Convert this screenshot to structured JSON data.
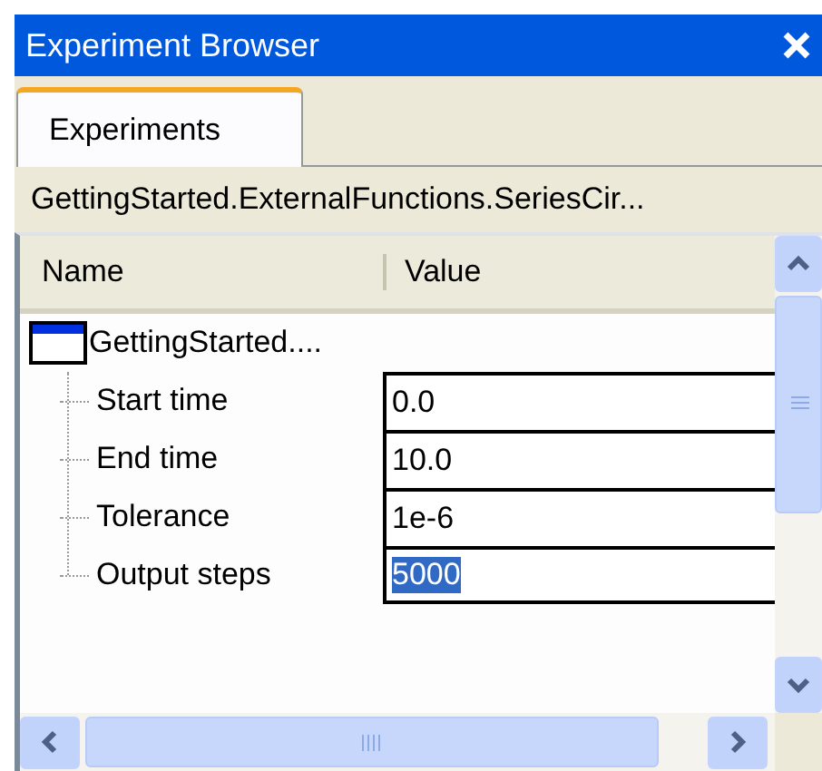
{
  "window": {
    "title": "Experiment Browser"
  },
  "tabs": [
    {
      "label": "Experiments",
      "selected": true
    }
  ],
  "path": "GettingStarted.ExternalFunctions.SeriesCir...",
  "table": {
    "columns": [
      "Name",
      "Value"
    ],
    "root": {
      "label": "GettingStarted....",
      "children": [
        {
          "name": "Start time",
          "value": "0.0",
          "selected": false
        },
        {
          "name": "End time",
          "value": "10.0",
          "selected": false
        },
        {
          "name": "Tolerance",
          "value": "1e-6",
          "selected": false
        },
        {
          "name": "Output steps",
          "value": "5000",
          "selected": true
        }
      ]
    }
  }
}
